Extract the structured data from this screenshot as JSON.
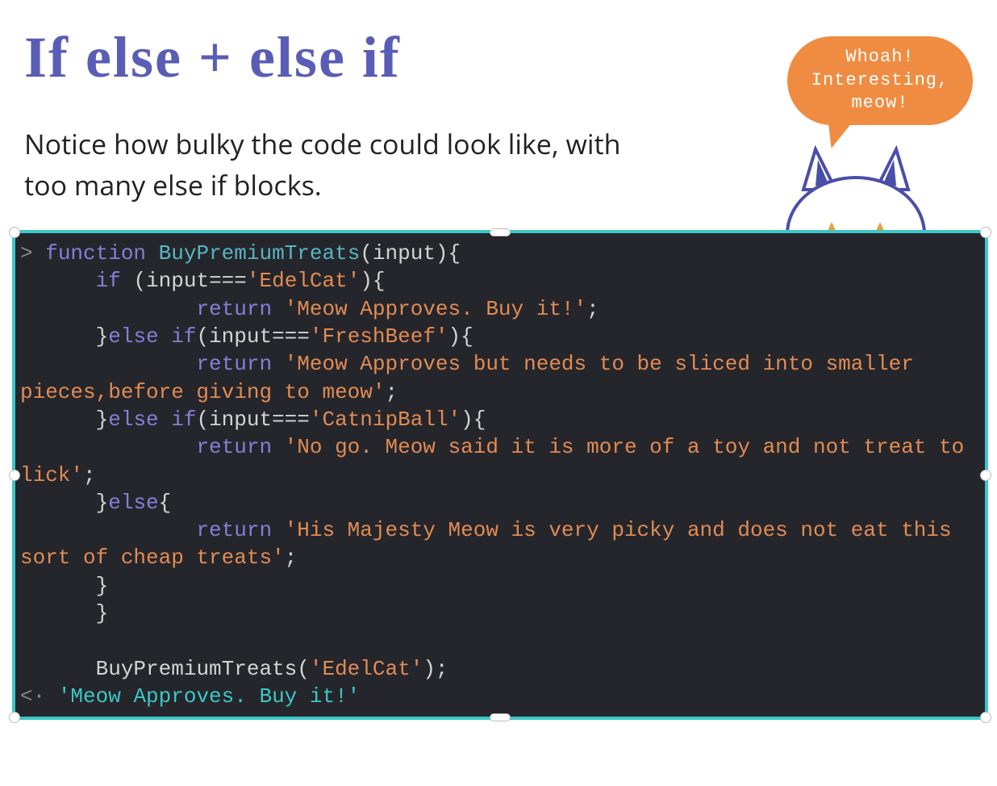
{
  "title": "If else + else if",
  "subtitle": "Notice how bulky the code could look like, with too many else if blocks.",
  "speech": "Whoah!\nInteresting,\nmeow!",
  "code": {
    "prompt_in": ">",
    "prompt_out": "<·",
    "fn_keyword": "function",
    "fn_name": "BuyPremiumTreats",
    "param": "input",
    "cond1_var": "input",
    "cond1_val": "'EdelCat'",
    "ret_kw": "return",
    "ret1": "'Meow Approves. Buy it!'",
    "cond2_var": "input",
    "cond2_val": "'FreshBeef'",
    "ret2": "'Meow Approves but needs to be sliced into smaller pieces,before giving to meow'",
    "cond3_var": "input",
    "cond3_val": "'CatnipBall'",
    "ret3": "'No go. Meow said it is more of a toy and not treat to lick'",
    "ret4": "'His Majesty Meow is very picky and does not eat this sort of cheap treats'",
    "else_kw": "else",
    "if_kw": "if",
    "elseif_kw": "else if",
    "call_name": "BuyPremiumTreats",
    "call_arg": "'EdelCat'",
    "output": "'Meow Approves. Buy it!'"
  }
}
